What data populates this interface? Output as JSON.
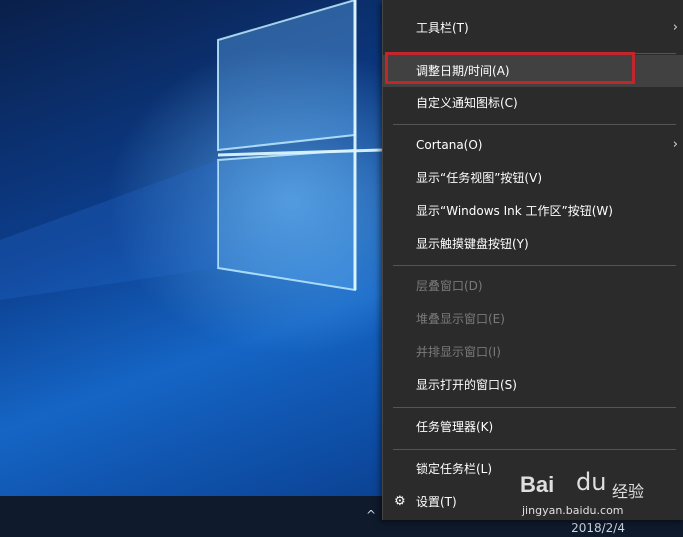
{
  "menu": {
    "items": [
      {
        "label": "工具栏(T)",
        "submenu": true
      },
      {
        "label": "调整日期/时间(A)",
        "highlighted": true
      },
      {
        "label": "自定义通知图标(C)"
      },
      {
        "label": "Cortana(O)",
        "submenu": true
      },
      {
        "label": "显示“任务视图”按钮(V)"
      },
      {
        "label": "显示“Windows Ink 工作区”按钮(W)"
      },
      {
        "label": "显示触摸键盘按钮(Y)"
      },
      {
        "label": "层叠窗口(D)",
        "disabled": true
      },
      {
        "label": "堆叠显示窗口(E)",
        "disabled": true
      },
      {
        "label": "并排显示窗口(I)",
        "disabled": true
      },
      {
        "label": "显示打开的窗口(S)"
      },
      {
        "label": "任务管理器(K)"
      },
      {
        "label": "锁定任务栏(L)"
      },
      {
        "label": "设置(T)",
        "icon": "gear-icon"
      }
    ],
    "chevron": "›",
    "highlight_color": "#c0262b"
  },
  "taskbar": {
    "date": "2018/2/4",
    "tray_glyph": "^"
  },
  "watermark": {
    "brand": "Bai",
    "paw": "du",
    "cn": "经验",
    "url": "jingyan.baidu.com"
  }
}
